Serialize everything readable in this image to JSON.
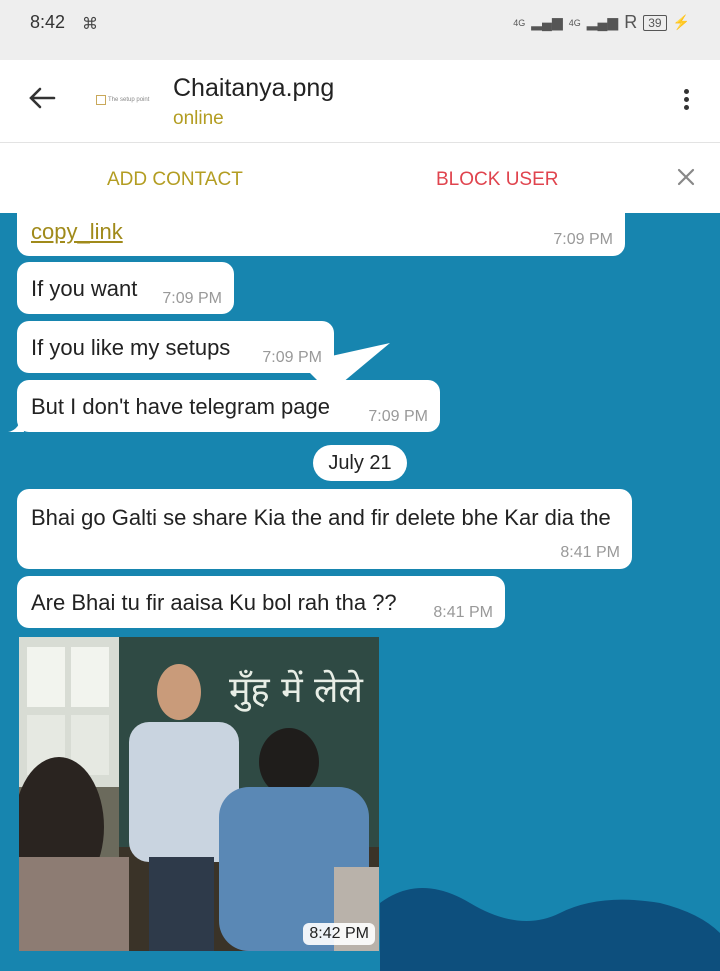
{
  "status": {
    "time": "8:42",
    "battery": "39",
    "signal1": "4G",
    "signal2": "4G",
    "roaming": "R"
  },
  "header": {
    "title": "Chaitanya.png",
    "subtitle": "online",
    "avatar_text": "The setup point"
  },
  "actions": {
    "add_contact": "ADD CONTACT",
    "block_user": "BLOCK USER"
  },
  "messages": [
    {
      "text": "copy_link",
      "time": "7:09 PM"
    },
    {
      "text": "If you want",
      "time": "7:09 PM"
    },
    {
      "text": "If you like my setups",
      "time": "7:09 PM"
    },
    {
      "text": "But I don't have telegram page",
      "time": "7:09 PM"
    },
    {
      "text": "Bhai go Galti se share Kia the and fir delete bhe Kar dia the",
      "time": "8:41 PM"
    },
    {
      "text": "Are Bhai tu fir aaisa Ku bol rah tha ??",
      "time": "8:41 PM"
    }
  ],
  "date_separator": "July 21",
  "photo": {
    "time": "8:42 PM",
    "caption": "मुँह में लेले"
  },
  "colors": {
    "chat_bg": "#1785af",
    "accent": "#b39d22",
    "danger": "#e0444e"
  }
}
